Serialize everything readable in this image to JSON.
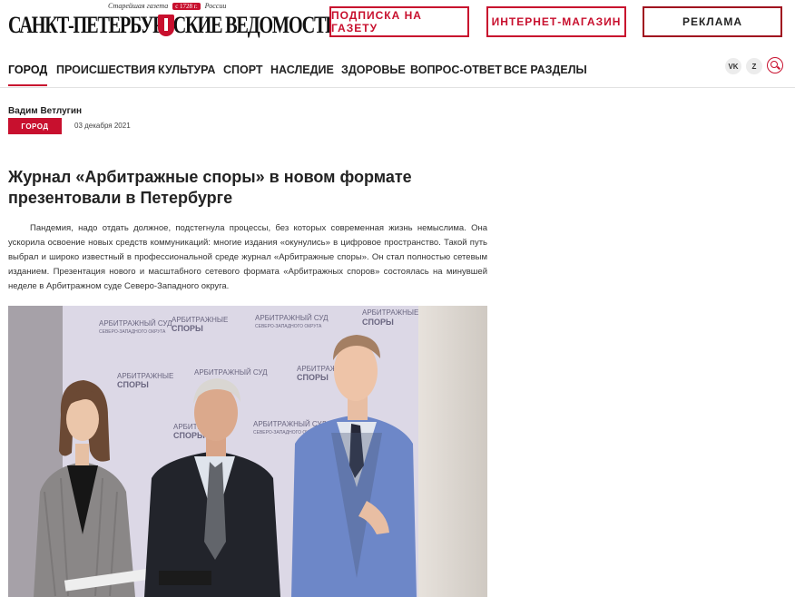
{
  "header": {
    "logo_tagline_left": "Старейшая газета",
    "logo_tagline_since": "с 1728 г.",
    "logo_tagline_right": "России",
    "logo_name": "САНКТ-ПЕТЕРБУРГСКИЕ  ВЕДОМОСТИ",
    "buttons": [
      "ПОДПИСКА НА ГАЗЕТУ",
      "ИНТЕРНЕТ-МАГАЗИН",
      "РЕКЛАМА"
    ]
  },
  "nav": {
    "items": [
      "ГОРОД",
      "ПРОИСШЕСТВИЯ",
      "КУЛЬТУРА",
      "СПОРТ",
      "НАСЛЕДИЕ",
      "ЗДОРОВЬЕ",
      "ВОПРОС-ОТВЕТ",
      "ВСЕ РАЗДЕЛЫ"
    ],
    "active": "ГОРОД",
    "social": [
      "vk",
      "dzen"
    ],
    "social_icons": [
      "vk-icon",
      "zen-icon"
    ],
    "search_icon": "search-icon"
  },
  "article": {
    "author": "Вадим Ветлугин",
    "tag": "ГОРОД",
    "date": "03 декабря 2021",
    "title": "Журнал «Арбитражные споры» в новом формате презентовали в Петербурге",
    "body": "Пандемия, надо отдать должное, подстегнула процессы, без которых современная жизнь немыслима. Она ускорила освоение новых средств коммуникаций: многие издания «окунулись» в цифровое пространство. Такой путь выбрал и широко известный в профессиональной среде журнал «Арбитражные споры». Он стал полностью сетевым изданием. Презентация нового и масштабного сетевого формата «Арбитражных споров» состоялась на минувшей неделе в Арбитражном суде Северо-Западного округа."
  },
  "photo": {
    "backdrop_texts": [
      "АРБИТРАЖНЫЙ СУД",
      "СЕВЕРО-ЗАПАДНОГО ОКРУГА",
      "АРБИТРАЖНЫЕ",
      "СПОРЫ"
    ]
  },
  "colors": {
    "accent": "#c8102e",
    "text": "#222222"
  }
}
